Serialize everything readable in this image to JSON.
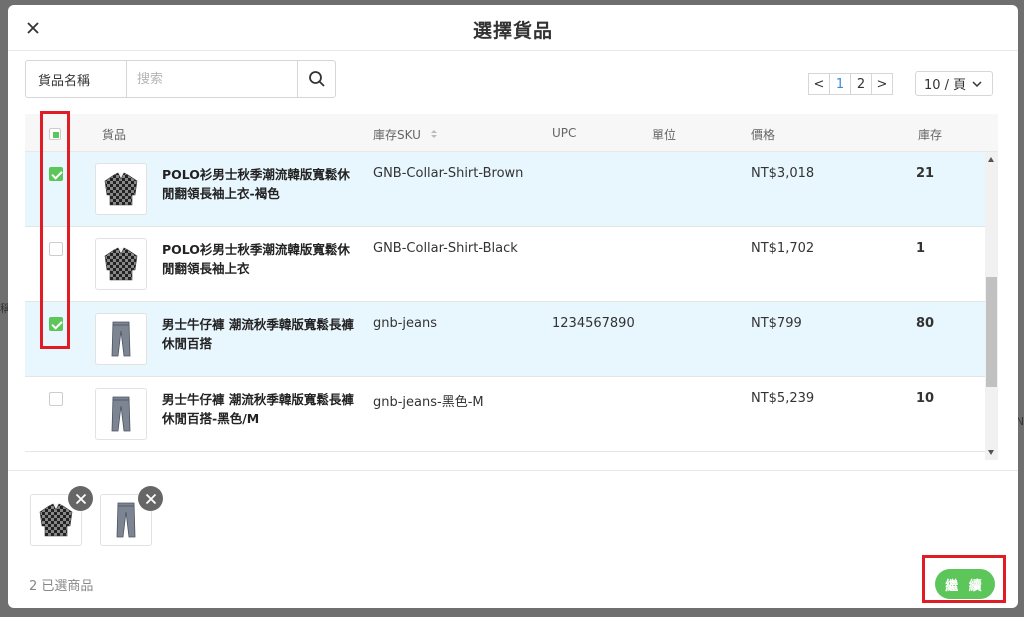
{
  "modal": {
    "title": "選擇貨品"
  },
  "search": {
    "field_label": "貨品名稱",
    "placeholder": "搜索"
  },
  "pagination": {
    "prev": "<",
    "pages": [
      "1",
      "2"
    ],
    "next": ">",
    "page_size": "10 / 頁"
  },
  "table": {
    "headers": {
      "product": "貨品",
      "sku": "庫存SKU",
      "upc": "UPC",
      "unit": "單位",
      "price": "價格",
      "stock": "庫存"
    },
    "rows": [
      {
        "name": "POLO衫男士秋季潮流韓版寬鬆休閒翻領長袖上衣-褐色",
        "sku": "GNB-Collar-Shirt-Brown",
        "upc": "",
        "unit": "",
        "price": "NT$3,018",
        "stock": "21",
        "selected": true,
        "thumb": "plaid-shirt-icon"
      },
      {
        "name": "POLO衫男士秋季潮流韓版寬鬆休閒翻領長袖上衣",
        "sku": "GNB-Collar-Shirt-Black",
        "upc": "",
        "unit": "",
        "price": "NT$1,702",
        "stock": "1",
        "selected": false,
        "thumb": "plaid-shirt-icon"
      },
      {
        "name": "男士牛仔褲 潮流秋季韓版寬鬆長褲休閒百搭",
        "sku": "gnb-jeans",
        "upc": "1234567890",
        "unit": "",
        "price": "NT$799",
        "stock": "80",
        "selected": true,
        "thumb": "jeans-icon"
      },
      {
        "name": "男士牛仔褲 潮流秋季韓版寬鬆長褲休閒百搭-黑色/M",
        "sku": "gnb-jeans-黑色-M",
        "upc": "",
        "unit": "",
        "price": "NT$5,239",
        "stock": "10",
        "selected": false,
        "thumb": "jeans-icon"
      }
    ]
  },
  "selected_items": [
    "plaid-shirt-icon",
    "jeans-icon"
  ],
  "footer": {
    "selected_count": "2 已選商品",
    "continue_label": "繼 續"
  },
  "background": {
    "left_fragment": "稱",
    "right_fragment": "N"
  },
  "colors": {
    "accent_green": "#5cc65b",
    "selected_row": "#e8f6fd",
    "highlight_red": "#e01c24",
    "link_blue": "#3a8ad6"
  }
}
